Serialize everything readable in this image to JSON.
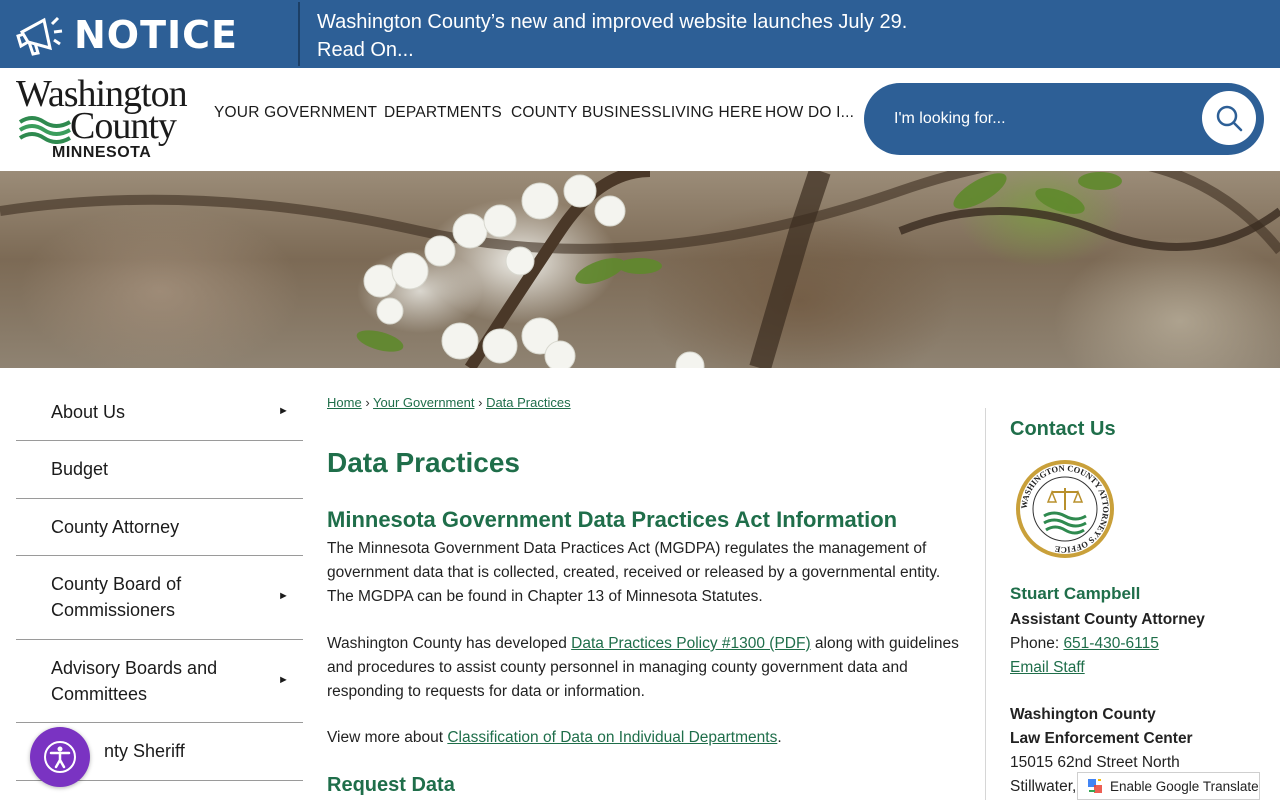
{
  "notice": {
    "label": "NOTICE",
    "line1": "Washington County’s new and improved website launches July 29.",
    "line2": "Read On..."
  },
  "logo": {
    "line1": "Washington",
    "line2": "County",
    "line3": "MINNESOTA",
    "wave_colors": [
      "#2f8a4f",
      "#3b9d5c",
      "#2f8a4f"
    ]
  },
  "nav": {
    "items": [
      {
        "label": "YOUR GOVERNMENT"
      },
      {
        "label": "DEPARTMENTS"
      },
      {
        "label": "COUNTY BUSINESS"
      },
      {
        "label": "LIVING HERE"
      },
      {
        "label": "HOW DO I..."
      }
    ]
  },
  "search": {
    "placeholder": "I'm looking for...",
    "icon": "search-icon"
  },
  "sidebar": {
    "items": [
      {
        "label": "About Us",
        "has_submenu": true
      },
      {
        "label": "Budget",
        "has_submenu": false
      },
      {
        "label": "County Attorney",
        "has_submenu": false
      },
      {
        "label": "County Board of Commissioners",
        "line1": "County Board of",
        "line2": "Commissioners",
        "has_submenu": true
      },
      {
        "label": "Advisory Boards and Committees",
        "line1": "Advisory Boards and",
        "line2": "Committees",
        "has_submenu": true
      },
      {
        "label": "County Sheriff",
        "visible_text": "nty Sheriff",
        "has_submenu": false
      }
    ],
    "arrow_glyph": "►"
  },
  "breadcrumb": {
    "items": [
      "Home",
      "Your Government",
      "Data Practices"
    ],
    "separator": "›"
  },
  "content": {
    "page_title": "Data Practices",
    "section1_title": "Minnesota Government Data Practices Act Information",
    "para1_l1": "The Minnesota Government Data Practices Act (MGDPA) regulates the management of",
    "para1_l2": "government data that is collected, created, received or released by a governmental entity.",
    "para1_l3": "The MGDPA can be found in Chapter 13 of Minnesota Statutes.",
    "para2_pre": "Washington County has developed ",
    "para2_link": "Data Practices Policy #1300 (PDF)",
    "para2_post": " along with guidelines",
    "para2_l2": "and procedures to assist county personnel in managing county government data and",
    "para2_l3": "responding to requests for data or information.",
    "para3_pre": "View more about ",
    "para3_link": "Classification of Data on Individual Departments",
    "para3_post": ".",
    "section2_title": "Request Data"
  },
  "contact": {
    "title": "Contact Us",
    "seal_text": "WASHINGTON COUNTY ATTORNEY'S OFFICE",
    "name": "Stuart Campbell",
    "role": "Assistant County Attorney",
    "phone_label": "Phone: ",
    "phone": "651-430-6115",
    "email_label": "Email Staff",
    "org_l1": "Washington County",
    "org_l2": "Law Enforcement Center",
    "addr_l1": "15015 62nd Street North",
    "addr_l2": "Stillwater,"
  },
  "widgets": {
    "accessibility_icon": "accessibility-icon",
    "translate_label": "Enable Google Translate"
  },
  "colors": {
    "notice_bg": "#2d5f96",
    "brand_green": "#1f6e4a",
    "search_bg": "#2d5f96",
    "accessibility_bg": "#7a33c2"
  }
}
